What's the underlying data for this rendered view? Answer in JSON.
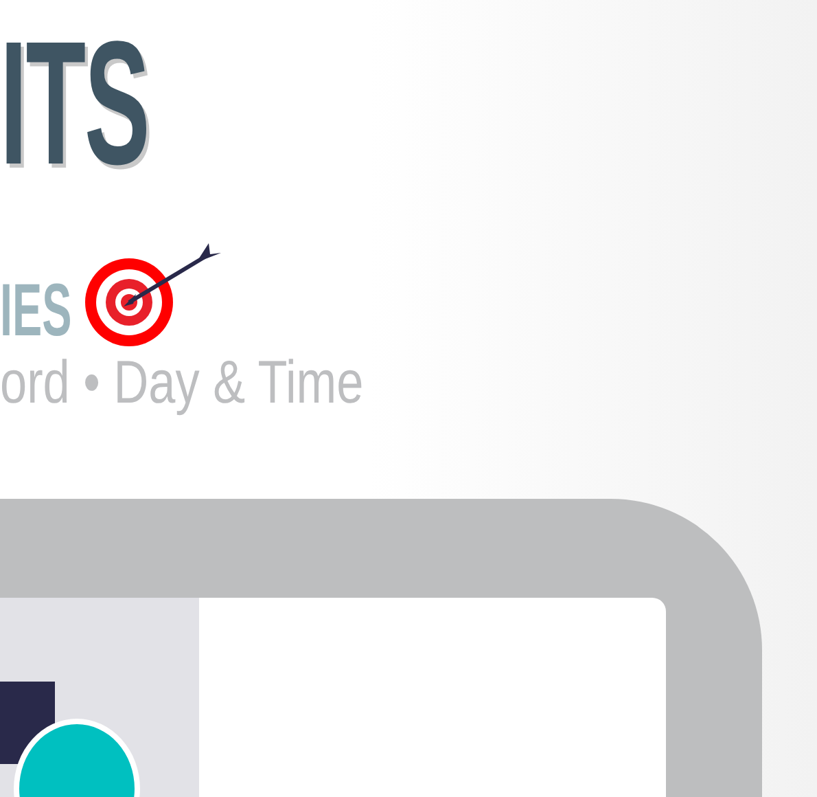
{
  "title": "ITS",
  "subtitle": "IES",
  "tagline": "ord • Day & Time"
}
